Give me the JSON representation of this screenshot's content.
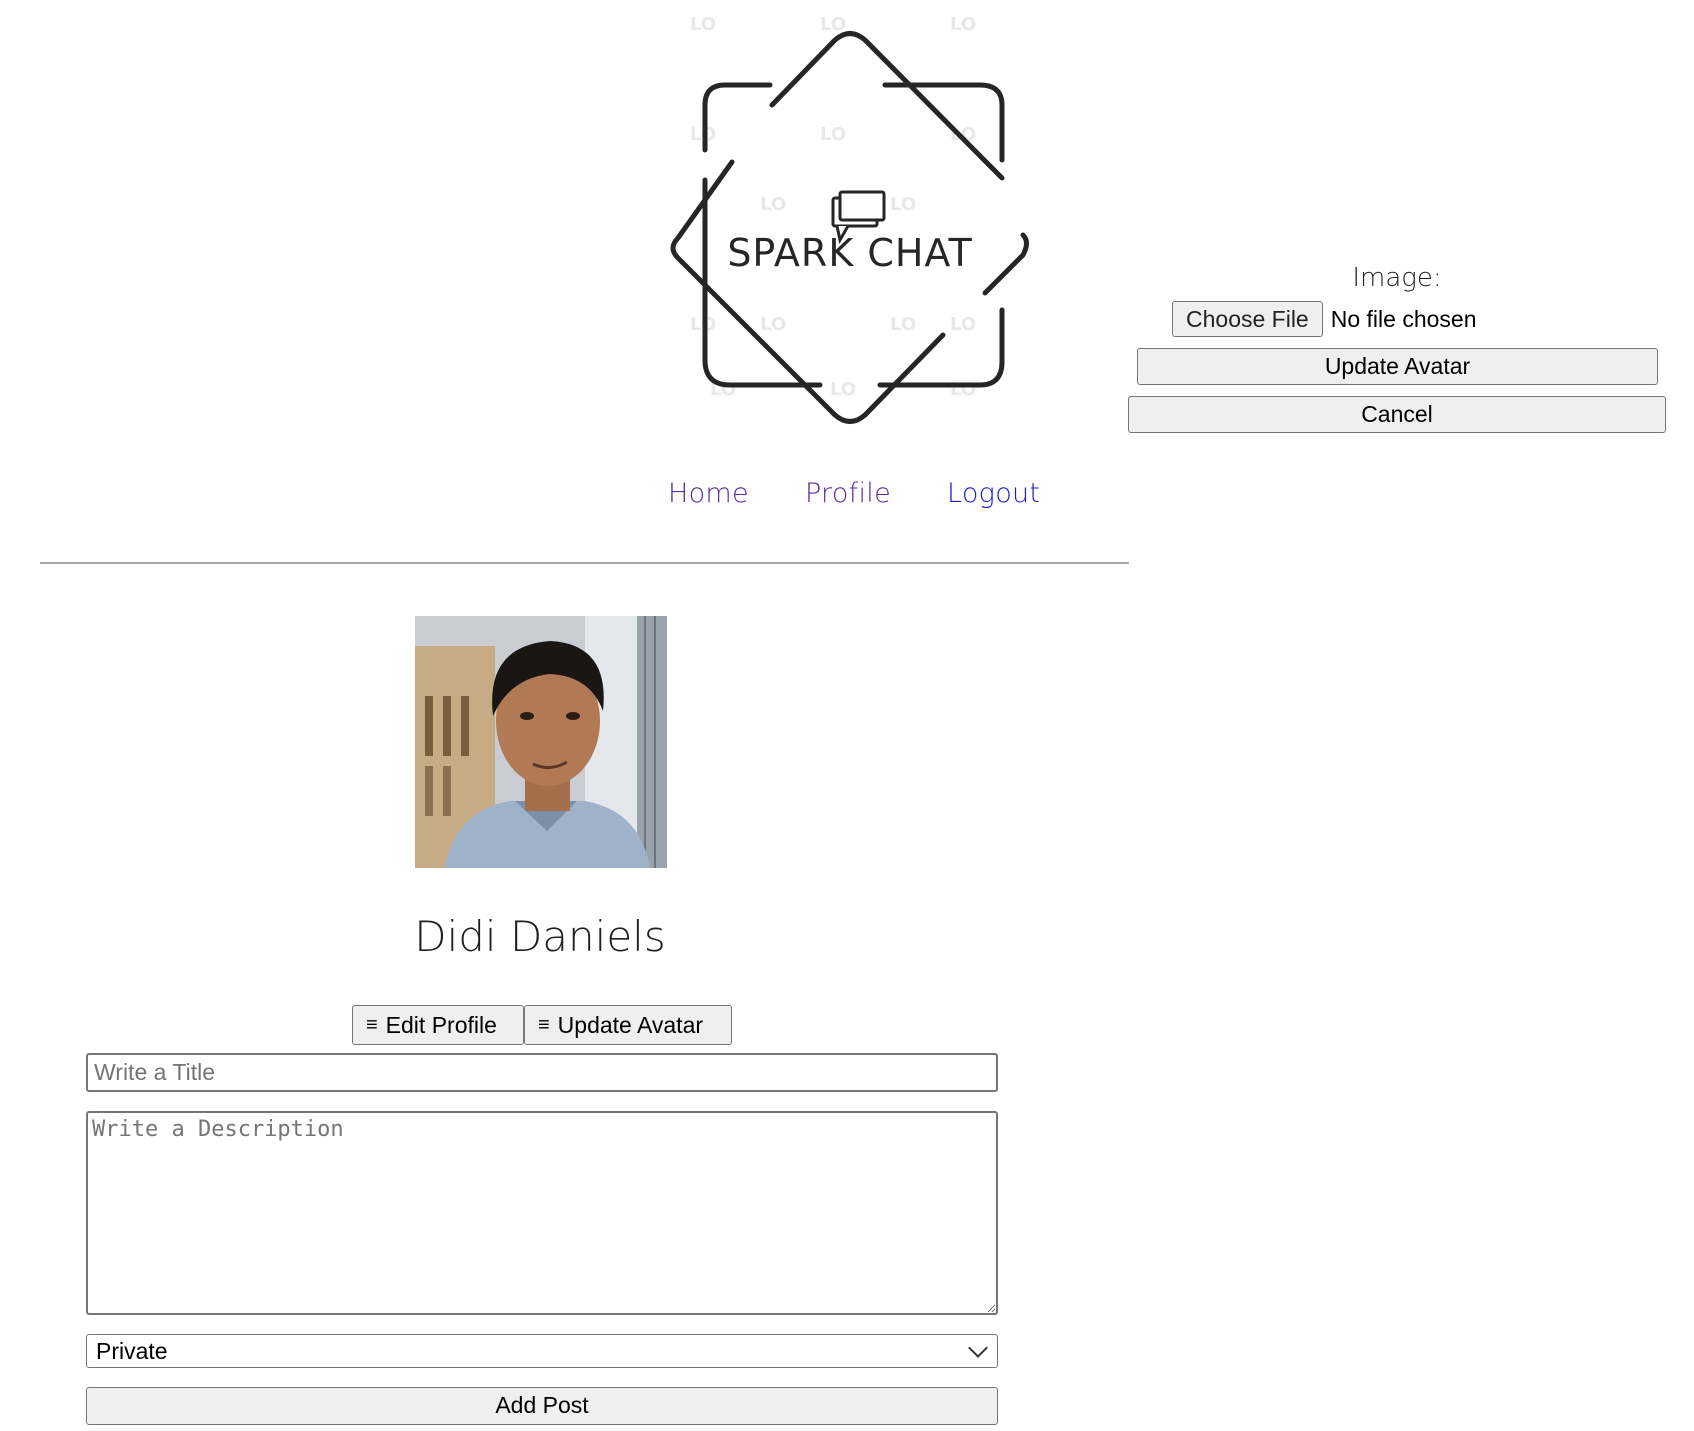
{
  "logo": {
    "text": "SPARK CHAT",
    "watermark": "LO GO"
  },
  "nav": {
    "items": [
      {
        "label": "Home",
        "state": "visited"
      },
      {
        "label": "Profile",
        "state": "visited"
      },
      {
        "label": "Logout",
        "state": "link"
      }
    ]
  },
  "avatar_form": {
    "image_label": "Image:",
    "choose_file_label": "Choose File",
    "file_status": "No file chosen",
    "update_label": "Update Avatar",
    "cancel_label": "Cancel"
  },
  "profile": {
    "name": "Didi Daniels",
    "edit_profile_label": "Edit Profile",
    "update_avatar_label": "Update Avatar",
    "menu_icon": "≡"
  },
  "post_form": {
    "title_placeholder": "Write a Title",
    "description_placeholder": "Write a Description",
    "visibility": "Private",
    "add_post_label": "Add Post"
  },
  "colors": {
    "visited_link": "#5b2b9a",
    "link": "#1a1ad6",
    "button_bg": "#efefef",
    "button_border": "#767676"
  }
}
